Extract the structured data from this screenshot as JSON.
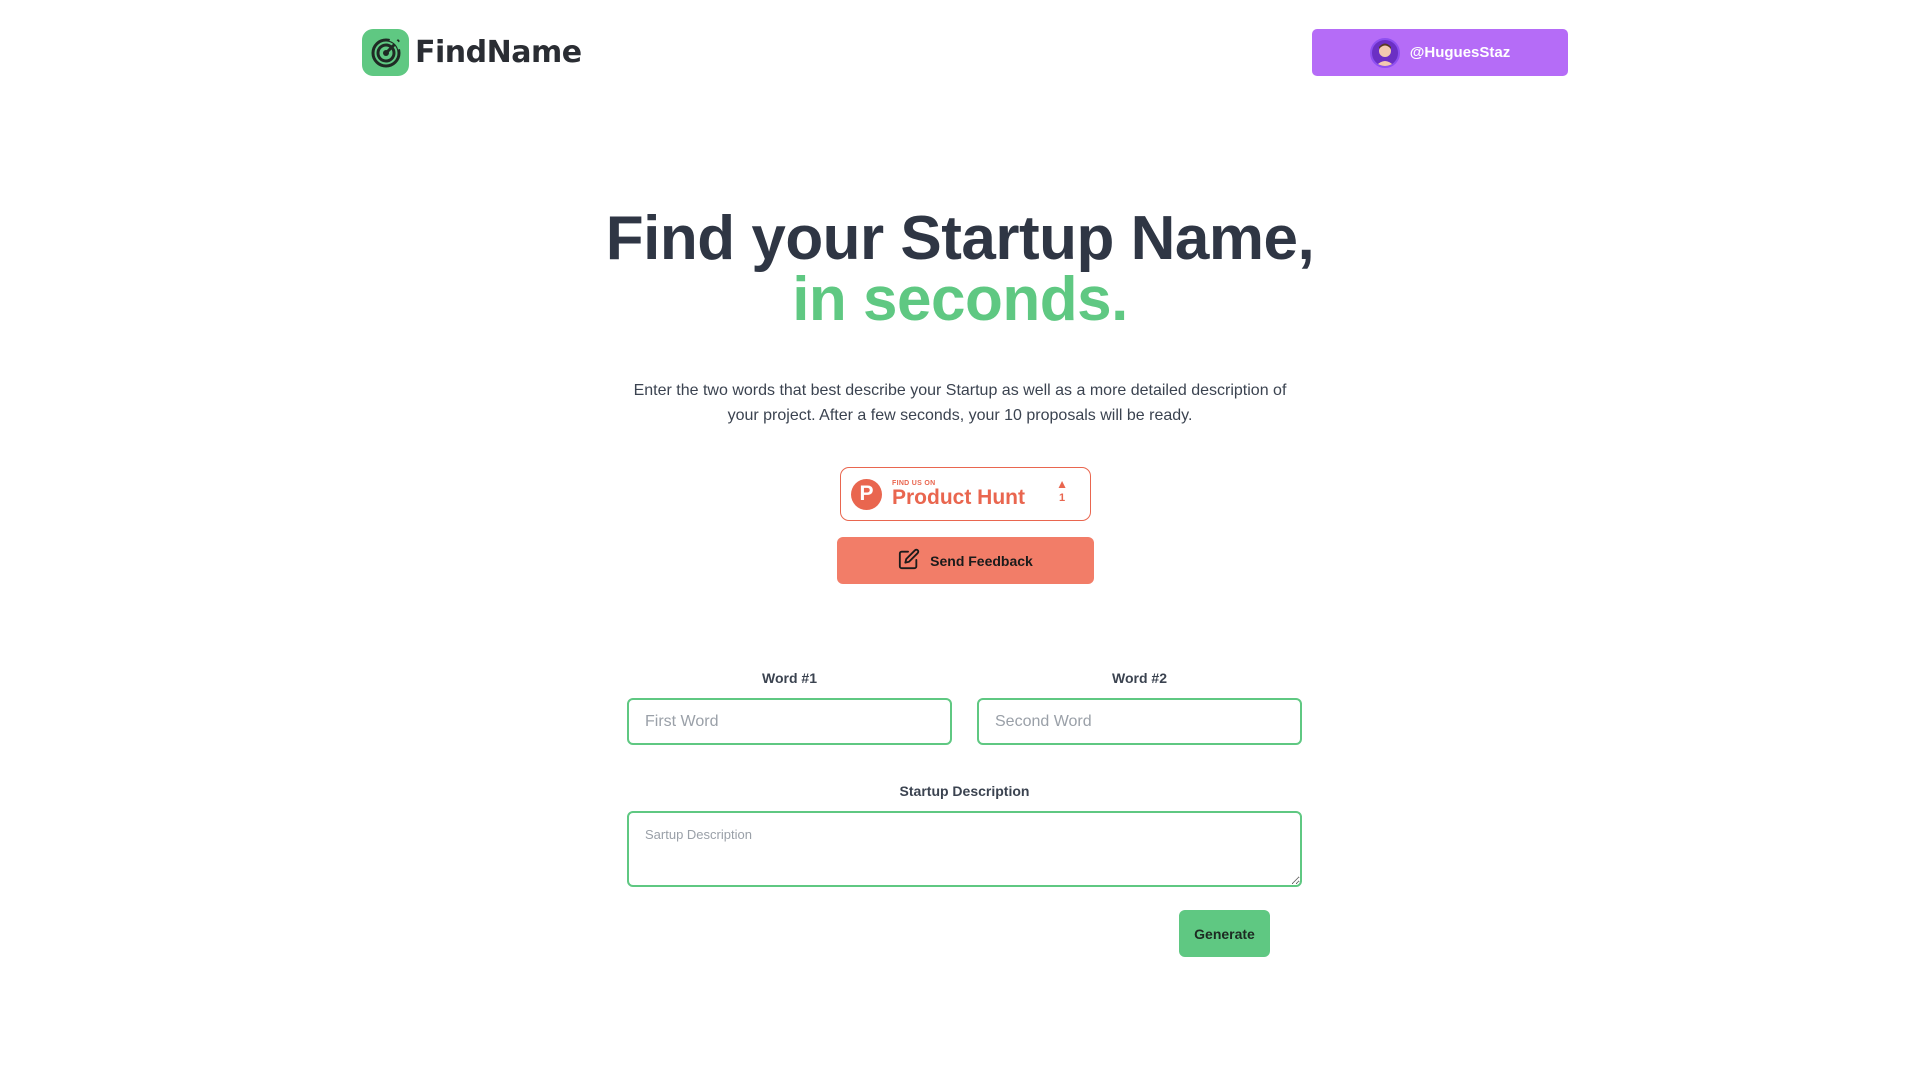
{
  "header": {
    "brand": "FindName",
    "twitter_handle": "@HuguesStaz"
  },
  "hero": {
    "title_line1": "Find your Startup Name,",
    "title_line2": "in seconds.",
    "subtitle": "Enter the two words that best describe your Startup as well as a more detailed description of your project. After a few seconds, your 10 proposals will be ready."
  },
  "product_hunt": {
    "small_label": "FIND US ON",
    "name": "Product Hunt",
    "votes": "1"
  },
  "feedback": {
    "label": "Send Feedback"
  },
  "form": {
    "word1_label": "Word #1",
    "word1_placeholder": "First Word",
    "word1_value": "",
    "word2_label": "Word #2",
    "word2_placeholder": "Second Word",
    "word2_value": "",
    "description_label": "Startup Description",
    "description_placeholder": "Sartup Description",
    "description_value": "",
    "generate_label": "Generate"
  },
  "colors": {
    "brand_green": "#5fc882",
    "twitter_purple": "#b56cf7",
    "product_hunt": "#e9664f",
    "feedback": "#f27d68",
    "heading": "#2f3644"
  },
  "icons": {
    "logo": "radar-icon",
    "feedback": "edit-icon",
    "product_hunt": "product-hunt-logo-icon",
    "vote": "upvote-triangle-icon"
  }
}
